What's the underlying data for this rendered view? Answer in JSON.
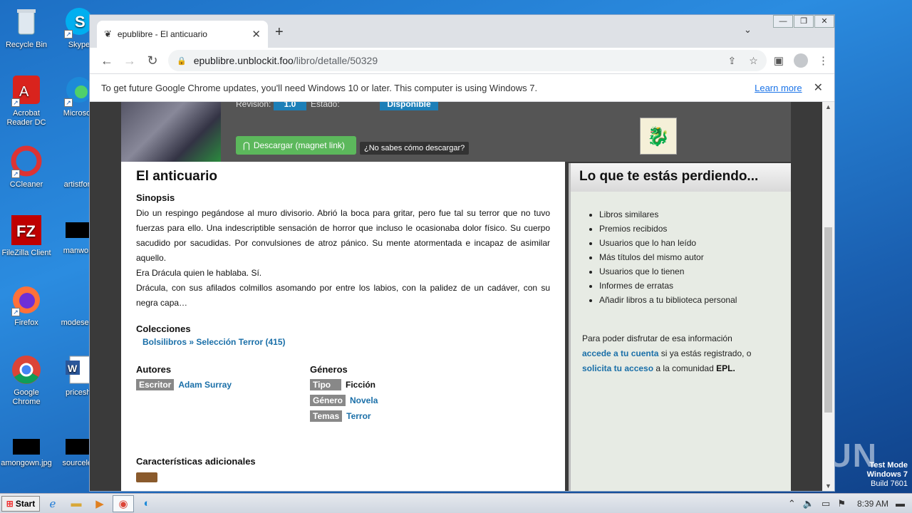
{
  "desktop": {
    "icons": [
      {
        "label": "Recycle Bin"
      },
      {
        "label": "Skype"
      },
      {
        "label": "Acrobat Reader DC"
      },
      {
        "label": "Microsoft"
      },
      {
        "label": "CCleaner"
      },
      {
        "label": "artistford"
      },
      {
        "label": "FileZilla Client"
      },
      {
        "label": "manwork"
      },
      {
        "label": "Firefox"
      },
      {
        "label": "modeseve"
      },
      {
        "label": "Google Chrome"
      },
      {
        "label": "priceshi"
      },
      {
        "label": "amongown.jpg"
      },
      {
        "label": "sourceles"
      }
    ],
    "watermark": "ANY RUN",
    "test_mode": {
      "line1": "Test Mode",
      "line2": "Windows 7",
      "line3": "Build 7601"
    }
  },
  "browser": {
    "tab_title": "epublibre - El anticuario",
    "url_host": "epublibre.unblockit.foo",
    "url_path": "/libro/detalle/50329",
    "infobar_text": "To get future Google Chrome updates, you'll need Windows 10 or later. This computer is using Windows 7.",
    "infobar_link": "Learn more"
  },
  "page": {
    "revision_label": "Revisión:",
    "revision_value": "1.0",
    "estado_label": "Estado:",
    "estado_value": "Disponible",
    "download_label": "Descargar (magnet link)",
    "howto_label": "¿No sabes cómo descargar?",
    "title": "El anticuario",
    "sinopsis_heading": "Sinopsis",
    "sinopsis": [
      "Dio un respingo pegándose al muro divisorio. Abrió la boca para gritar, pero fue tal su terror que no tuvo fuerzas para ello. Una indescriptible sensación de horror que incluso le ocasionaba dolor físico. Su cuerpo sacudido por sacudidas. Por convulsiones de atroz pánico. Su mente atormentada e incapaz de asimilar aquello.",
      "Era Drácula quien le hablaba. Sí.",
      "Drácula, con sus afilados colmillos asomando por entre los labios, con la palidez de un cadáver, con su negra capa…"
    ],
    "colecciones_heading": "Colecciones",
    "coleccion": "Bolsilibros » Selección Terror (415)",
    "autores_heading": "Autores",
    "autor_tag": "Escritor",
    "autor_name": "Adam Surray",
    "generos_heading": "Géneros",
    "generos": [
      {
        "tag": "Tipo",
        "value": "Ficción"
      },
      {
        "tag": "Género",
        "value": "Novela"
      },
      {
        "tag": "Temas",
        "value": "Terror"
      }
    ],
    "caracteristicas_heading": "Características adicionales"
  },
  "sidebar": {
    "heading": "Lo que te estás perdiendo...",
    "items": [
      "Libros similares",
      "Premios recibidos",
      "Usuarios que lo han leído",
      "Más títulos del mismo autor",
      "Usuarios que lo tienen",
      "Informes de erratas",
      "Añadir libros a tu biblioteca personal"
    ],
    "info_pre": "Para poder disfrutar de esa información",
    "info_link1": "accede a tu cuenta",
    "info_mid": "si ya estás registrado, o",
    "info_link2": "solicita tu acceso",
    "info_post": "a la comunidad",
    "info_epl": "EPL."
  },
  "taskbar": {
    "start_label": "Start",
    "clock": "8:39 AM"
  }
}
